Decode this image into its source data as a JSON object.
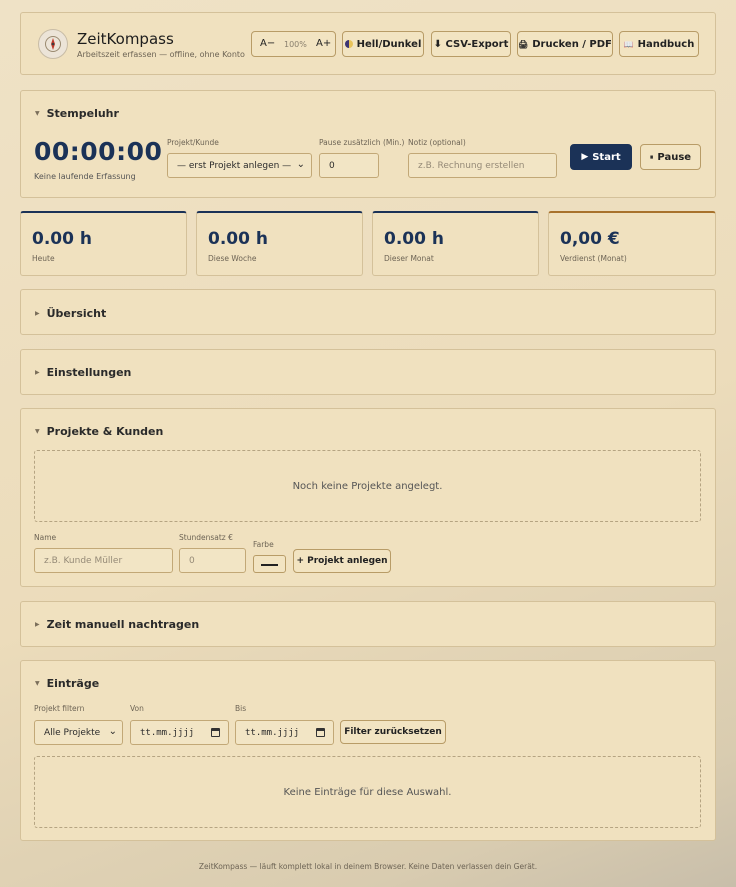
{
  "app": {
    "title": "ZeitKompass",
    "subtitle": "Arbeitszeit erfassen — offline, ohne Konto"
  },
  "toolbar": {
    "font_smaller": "A−",
    "zoom": "100%",
    "font_larger": "A+",
    "theme_label": "Hell/Dunkel",
    "csv_label": "⬇ CSV-Export",
    "print_label": "Drucken / PDF",
    "manual_label": "Handbuch"
  },
  "stempeluhr": {
    "title": "Stempeluhr",
    "timer": "00:00:00",
    "status": "Keine laufende Erfassung",
    "project_label": "Projekt/Kunde",
    "project_value": "— erst Projekt anlegen —",
    "pause_label": "Pause zusätzlich (Min.)",
    "pause_value": "0",
    "note_label": "Notiz (optional)",
    "note_placeholder": "z.B. Rechnung erstellen",
    "start_label": "Start",
    "pause_button": "Pause"
  },
  "stats": [
    {
      "value": "0.00 h",
      "caption": "Heute"
    },
    {
      "value": "0.00 h",
      "caption": "Diese Woche"
    },
    {
      "value": "0.00 h",
      "caption": "Dieser Monat"
    },
    {
      "value": "0,00 €",
      "caption": "Verdienst (Monat)"
    }
  ],
  "sections": {
    "overview": "Übersicht",
    "settings": "Einstellungen",
    "projects": "Projekte & Kunden",
    "manual_entry": "Zeit manuell nachtragen",
    "entries": "Einträge"
  },
  "projects": {
    "empty_text": "Noch keine Projekte angelegt.",
    "name_label": "Name",
    "name_placeholder": "z.B. Kunde Müller",
    "rate_label": "Stundensatz €",
    "rate_placeholder": "0",
    "color_label": "Farbe",
    "add_button": "+ Projekt anlegen"
  },
  "entries": {
    "filter_label": "Projekt filtern",
    "filter_value": "Alle Projekte",
    "from_label": "Von",
    "from_value": "tt.mm.jjjj",
    "to_label": "Bis",
    "to_value": "tt.mm.jjjj",
    "reset_button": "Filter zurücksetzen",
    "empty_text": "Keine Einträge für diese Auswahl."
  },
  "footer": "ZeitKompass — läuft komplett lokal in deinem Browser. Keine Daten verlassen dein Gerät.",
  "colors": {
    "accent_navy": "#1b3257",
    "earnings_accent": "#a8722c",
    "background": "#ecdcbb"
  }
}
